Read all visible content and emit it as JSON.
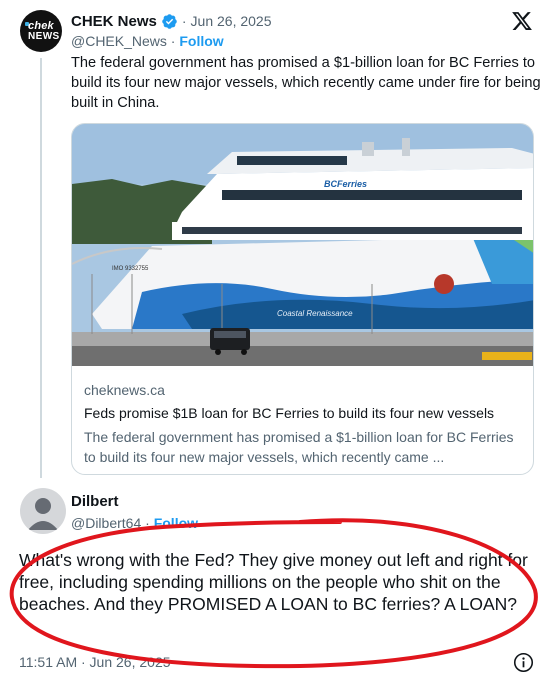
{
  "post": {
    "display_name": "CHEK News",
    "date_separator": "·",
    "date": "Jun 26, 2025",
    "handle": "@CHEK_News",
    "handle_separator": "·",
    "follow_label": "Follow",
    "avatar_text_top": "chek",
    "avatar_text_bottom": "NEWS",
    "text": "The federal government has promised a $1-billion loan for BC Ferries to build its four new major vessels, which recently came under fire for being built in China.",
    "icons": {
      "verified": "verified-badge-icon",
      "brand": "x-logo-icon"
    },
    "card": {
      "domain": "cheknews.ca",
      "title": "Feds promise $1B loan for BC Ferries to build its four new vessels",
      "description": "The federal government has promised a $1-billion loan for BC Ferries to build its four new major vessels, which recently came ...",
      "image": {
        "ship_brand": "BCFerries",
        "hull_text": "Coastal Renaissance",
        "imo_text": "IMO 9332755"
      }
    }
  },
  "reply": {
    "display_name": "Dilbert",
    "handle": "@Dilbert64",
    "handle_separator": "·",
    "follow_label": "Follow",
    "text": "What's wrong with the Fed?  They give money out left and right for free, including spending millions on the people who shit on the beaches.  And they PROMISED A  LOAN to BC ferries?  A LOAN?",
    "time": "11:51 AM · Jun 26, 2025",
    "icons": {
      "avatar": "default-avatar-icon",
      "info": "info-icon"
    }
  },
  "colors": {
    "accent": "#1d9bf0",
    "secondary_text": "#536471",
    "annotation": "#e0161d"
  }
}
